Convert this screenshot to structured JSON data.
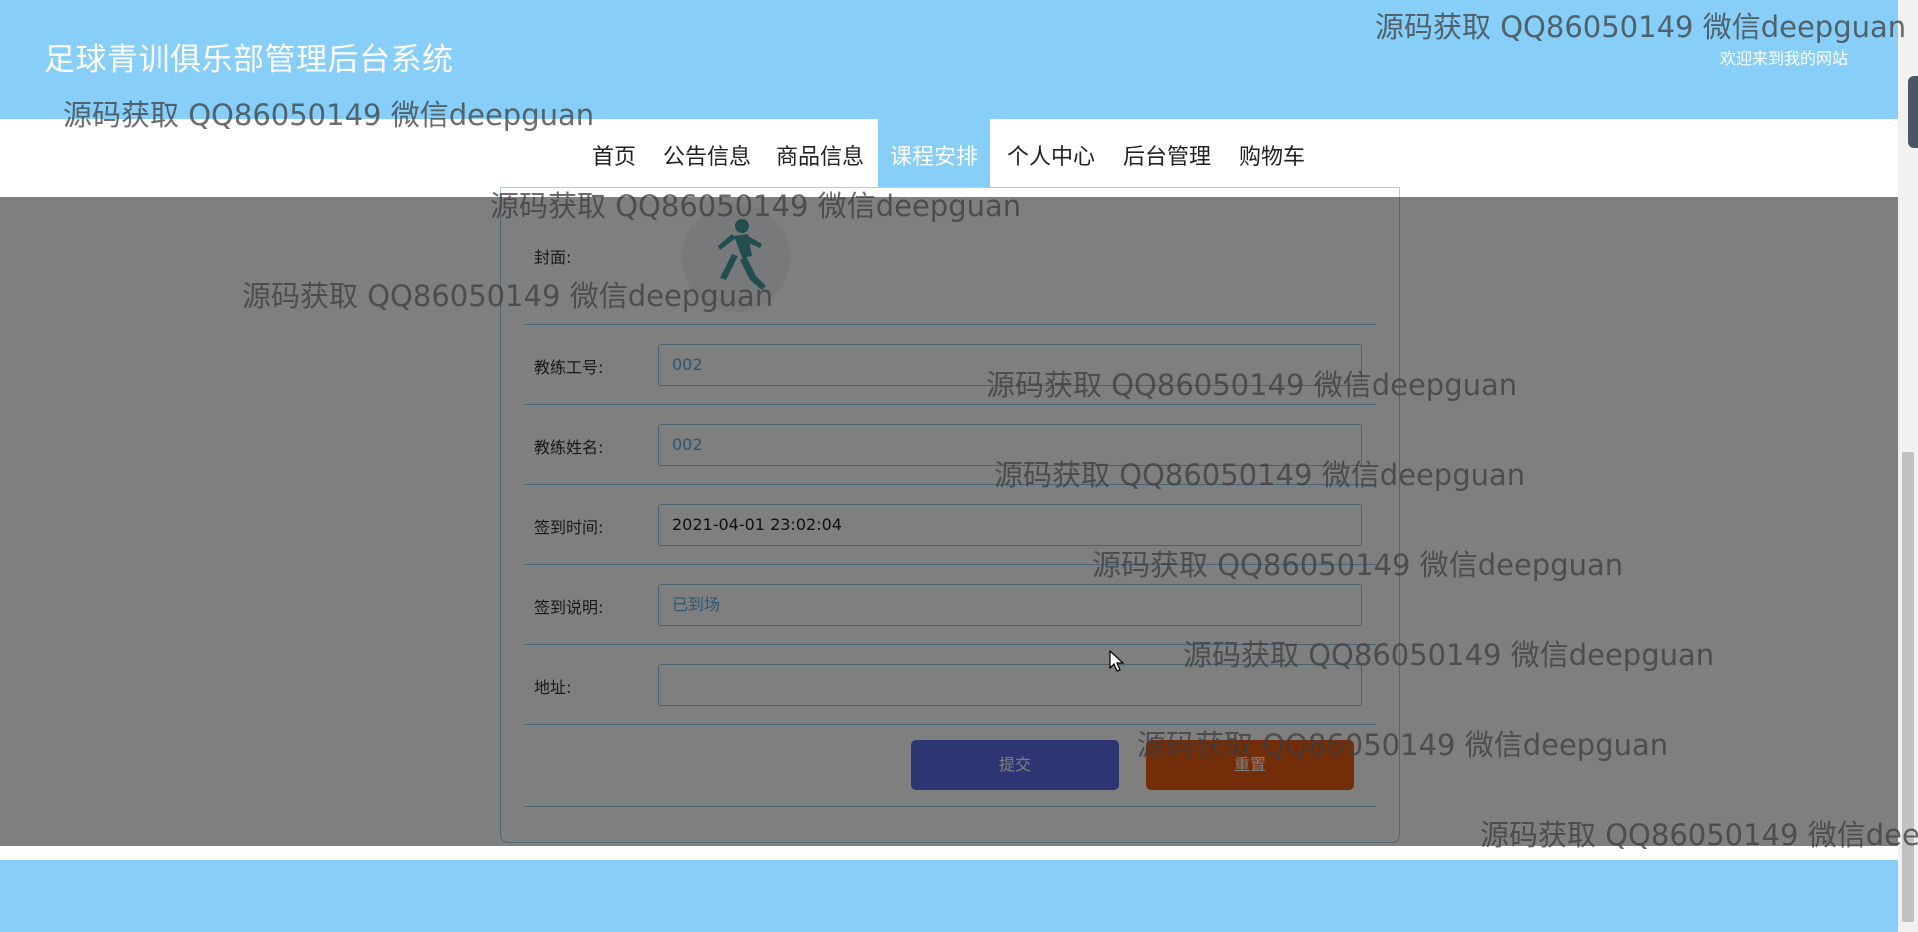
{
  "header": {
    "title": "足球青训俱乐部管理后台系统",
    "welcome": "欢迎来到我的网站"
  },
  "nav": {
    "items": [
      {
        "label": "首页"
      },
      {
        "label": "公告信息"
      },
      {
        "label": "商品信息"
      },
      {
        "label": "课程安排",
        "active": true
      },
      {
        "label": "个人中心"
      },
      {
        "label": "后台管理"
      },
      {
        "label": "购物车"
      }
    ]
  },
  "form": {
    "cover_label": "封面:",
    "coach_id_label": "教练工号:",
    "coach_id_value": "002",
    "coach_name_label": "教练姓名:",
    "coach_name_value": "002",
    "checkin_time_label": "签到时间:",
    "checkin_time_value": "2021-04-01 23:02:04",
    "checkin_note_label": "签到说明:",
    "checkin_note_placeholder": "已到场",
    "address_label": "地址:",
    "address_value": "",
    "submit_label": "提交",
    "reset_label": "重置"
  },
  "watermark": {
    "text": "源码获取 QQ86050149 微信deepguan"
  },
  "colors": {
    "header_bg": "#87cef8",
    "submit_bg": "#5a6be6",
    "reset_bg": "#e85a12",
    "field_border": "#8fc9ea"
  }
}
